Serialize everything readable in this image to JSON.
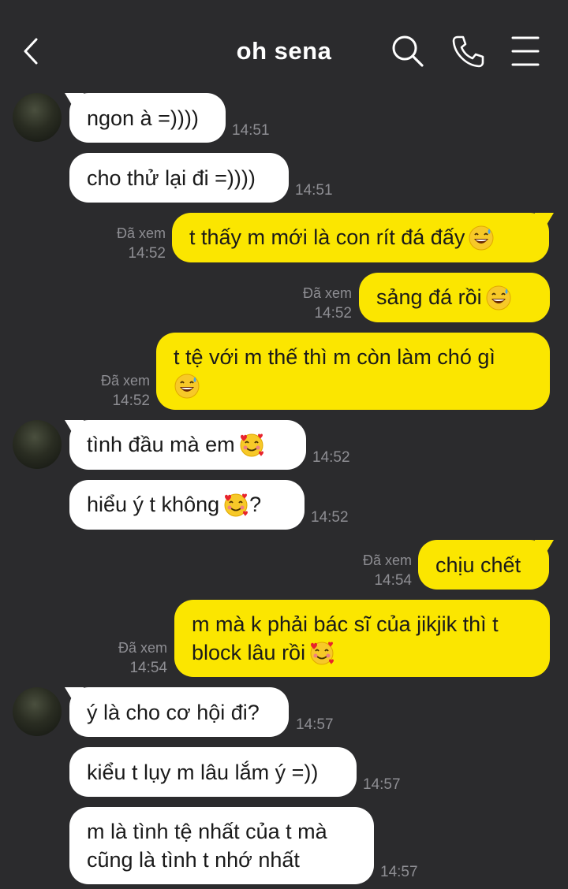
{
  "header": {
    "title": "oh sena"
  },
  "messages": [
    {
      "dir": "in",
      "text": "ngon à =))))",
      "time": "14:51"
    },
    {
      "dir": "in",
      "text": "cho thử lại đi =))))",
      "time": "14:51"
    },
    {
      "dir": "out",
      "text": "t thấy m mới là con rít đá đấy",
      "emoji": "sweat-smile",
      "status": "Đã xem",
      "time": "14:52"
    },
    {
      "dir": "out",
      "text": "sảng đá rồi",
      "emoji": "sweat-smile",
      "status": "Đã xem",
      "time": "14:52"
    },
    {
      "dir": "out",
      "text": "t tệ với m thế thì m còn làm chó gì",
      "emoji": "sweat-smile",
      "status": "Đã xem",
      "time": "14:52"
    },
    {
      "dir": "in",
      "text": "tình đầu mà em",
      "emoji": "smiling-hearts",
      "time": "14:52"
    },
    {
      "dir": "in",
      "text": "hiểu ý t không",
      "emoji": "smiling-hearts",
      "suffix": "?",
      "time": "14:52"
    },
    {
      "dir": "out",
      "text": "chịu chết",
      "status": "Đã xem",
      "time": "14:54"
    },
    {
      "dir": "out",
      "text": "m mà k phải bác sĩ của jikjik thì t block lâu rồi",
      "emoji": "smiling-hearts",
      "status": "Đã xem",
      "time": "14:54"
    },
    {
      "dir": "in",
      "text": "ý là cho cơ hội đi?",
      "time": "14:57"
    },
    {
      "dir": "in",
      "text": "kiểu t lụy m lâu lắm ý =))",
      "time": "14:57"
    },
    {
      "dir": "in",
      "text": "m là tình tệ nhất của t mà cũng là tình t nhớ nhất",
      "time": "14:57"
    }
  ]
}
